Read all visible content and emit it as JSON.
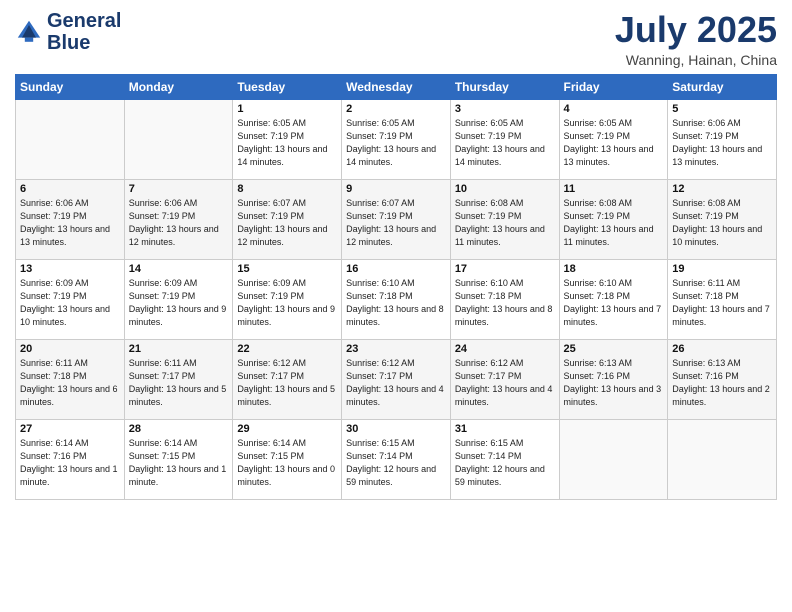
{
  "logo": {
    "text_general": "General",
    "text_blue": "Blue"
  },
  "title": "July 2025",
  "subtitle": "Wanning, Hainan, China",
  "days_of_week": [
    "Sunday",
    "Monday",
    "Tuesday",
    "Wednesday",
    "Thursday",
    "Friday",
    "Saturday"
  ],
  "weeks": [
    [
      {
        "day": "",
        "info": ""
      },
      {
        "day": "",
        "info": ""
      },
      {
        "day": "1",
        "info": "Sunrise: 6:05 AM\nSunset: 7:19 PM\nDaylight: 13 hours\nand 14 minutes."
      },
      {
        "day": "2",
        "info": "Sunrise: 6:05 AM\nSunset: 7:19 PM\nDaylight: 13 hours\nand 14 minutes."
      },
      {
        "day": "3",
        "info": "Sunrise: 6:05 AM\nSunset: 7:19 PM\nDaylight: 13 hours\nand 14 minutes."
      },
      {
        "day": "4",
        "info": "Sunrise: 6:05 AM\nSunset: 7:19 PM\nDaylight: 13 hours\nand 13 minutes."
      },
      {
        "day": "5",
        "info": "Sunrise: 6:06 AM\nSunset: 7:19 PM\nDaylight: 13 hours\nand 13 minutes."
      }
    ],
    [
      {
        "day": "6",
        "info": "Sunrise: 6:06 AM\nSunset: 7:19 PM\nDaylight: 13 hours\nand 13 minutes."
      },
      {
        "day": "7",
        "info": "Sunrise: 6:06 AM\nSunset: 7:19 PM\nDaylight: 13 hours\nand 12 minutes."
      },
      {
        "day": "8",
        "info": "Sunrise: 6:07 AM\nSunset: 7:19 PM\nDaylight: 13 hours\nand 12 minutes."
      },
      {
        "day": "9",
        "info": "Sunrise: 6:07 AM\nSunset: 7:19 PM\nDaylight: 13 hours\nand 12 minutes."
      },
      {
        "day": "10",
        "info": "Sunrise: 6:08 AM\nSunset: 7:19 PM\nDaylight: 13 hours\nand 11 minutes."
      },
      {
        "day": "11",
        "info": "Sunrise: 6:08 AM\nSunset: 7:19 PM\nDaylight: 13 hours\nand 11 minutes."
      },
      {
        "day": "12",
        "info": "Sunrise: 6:08 AM\nSunset: 7:19 PM\nDaylight: 13 hours\nand 10 minutes."
      }
    ],
    [
      {
        "day": "13",
        "info": "Sunrise: 6:09 AM\nSunset: 7:19 PM\nDaylight: 13 hours\nand 10 minutes."
      },
      {
        "day": "14",
        "info": "Sunrise: 6:09 AM\nSunset: 7:19 PM\nDaylight: 13 hours\nand 9 minutes."
      },
      {
        "day": "15",
        "info": "Sunrise: 6:09 AM\nSunset: 7:19 PM\nDaylight: 13 hours\nand 9 minutes."
      },
      {
        "day": "16",
        "info": "Sunrise: 6:10 AM\nSunset: 7:18 PM\nDaylight: 13 hours\nand 8 minutes."
      },
      {
        "day": "17",
        "info": "Sunrise: 6:10 AM\nSunset: 7:18 PM\nDaylight: 13 hours\nand 8 minutes."
      },
      {
        "day": "18",
        "info": "Sunrise: 6:10 AM\nSunset: 7:18 PM\nDaylight: 13 hours\nand 7 minutes."
      },
      {
        "day": "19",
        "info": "Sunrise: 6:11 AM\nSunset: 7:18 PM\nDaylight: 13 hours\nand 7 minutes."
      }
    ],
    [
      {
        "day": "20",
        "info": "Sunrise: 6:11 AM\nSunset: 7:18 PM\nDaylight: 13 hours\nand 6 minutes."
      },
      {
        "day": "21",
        "info": "Sunrise: 6:11 AM\nSunset: 7:17 PM\nDaylight: 13 hours\nand 5 minutes."
      },
      {
        "day": "22",
        "info": "Sunrise: 6:12 AM\nSunset: 7:17 PM\nDaylight: 13 hours\nand 5 minutes."
      },
      {
        "day": "23",
        "info": "Sunrise: 6:12 AM\nSunset: 7:17 PM\nDaylight: 13 hours\nand 4 minutes."
      },
      {
        "day": "24",
        "info": "Sunrise: 6:12 AM\nSunset: 7:17 PM\nDaylight: 13 hours\nand 4 minutes."
      },
      {
        "day": "25",
        "info": "Sunrise: 6:13 AM\nSunset: 7:16 PM\nDaylight: 13 hours\nand 3 minutes."
      },
      {
        "day": "26",
        "info": "Sunrise: 6:13 AM\nSunset: 7:16 PM\nDaylight: 13 hours\nand 2 minutes."
      }
    ],
    [
      {
        "day": "27",
        "info": "Sunrise: 6:14 AM\nSunset: 7:16 PM\nDaylight: 13 hours\nand 1 minute."
      },
      {
        "day": "28",
        "info": "Sunrise: 6:14 AM\nSunset: 7:15 PM\nDaylight: 13 hours\nand 1 minute."
      },
      {
        "day": "29",
        "info": "Sunrise: 6:14 AM\nSunset: 7:15 PM\nDaylight: 13 hours\nand 0 minutes."
      },
      {
        "day": "30",
        "info": "Sunrise: 6:15 AM\nSunset: 7:14 PM\nDaylight: 12 hours\nand 59 minutes."
      },
      {
        "day": "31",
        "info": "Sunrise: 6:15 AM\nSunset: 7:14 PM\nDaylight: 12 hours\nand 59 minutes."
      },
      {
        "day": "",
        "info": ""
      },
      {
        "day": "",
        "info": ""
      }
    ]
  ]
}
